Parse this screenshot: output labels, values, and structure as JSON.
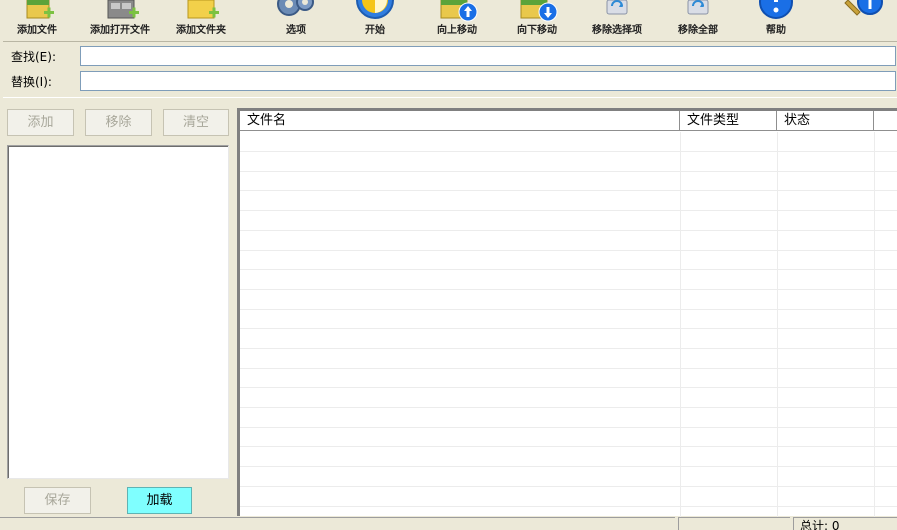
{
  "toolbar": {
    "items": [
      {
        "label": "添加文件",
        "icon": "add-file-icon"
      },
      {
        "label": "添加打开文件",
        "icon": "add-open-file-icon"
      },
      {
        "label": "添加文件夹",
        "icon": "add-folder-icon"
      },
      {
        "label": "选项",
        "icon": "gear-icon"
      },
      {
        "label": "开始",
        "icon": "start-icon"
      },
      {
        "label": "向上移动",
        "icon": "move-up-icon"
      },
      {
        "label": "向下移动",
        "icon": "move-down-icon"
      },
      {
        "label": "移除选择项",
        "icon": "remove-selected-icon"
      },
      {
        "label": "移除全部",
        "icon": "remove-all-icon"
      },
      {
        "label": "帮助",
        "icon": "help-icon"
      },
      {
        "label": "",
        "icon": "about-icon"
      }
    ]
  },
  "find": {
    "label": "查找(E):",
    "value": ""
  },
  "replace": {
    "label": "替换(I):",
    "value": ""
  },
  "left_panel": {
    "add_label": "添加",
    "remove_label": "移除",
    "clear_label": "清空",
    "save_label": "保存",
    "load_label": "加载"
  },
  "table": {
    "columns": [
      "文件名",
      "文件类型",
      "状态"
    ],
    "rows": []
  },
  "statusbar": {
    "total": "总计: 0"
  },
  "colors": {
    "window_bg": "#ece9d8",
    "load_button": "#7fffff",
    "help_blue": "#1a6fe6"
  }
}
